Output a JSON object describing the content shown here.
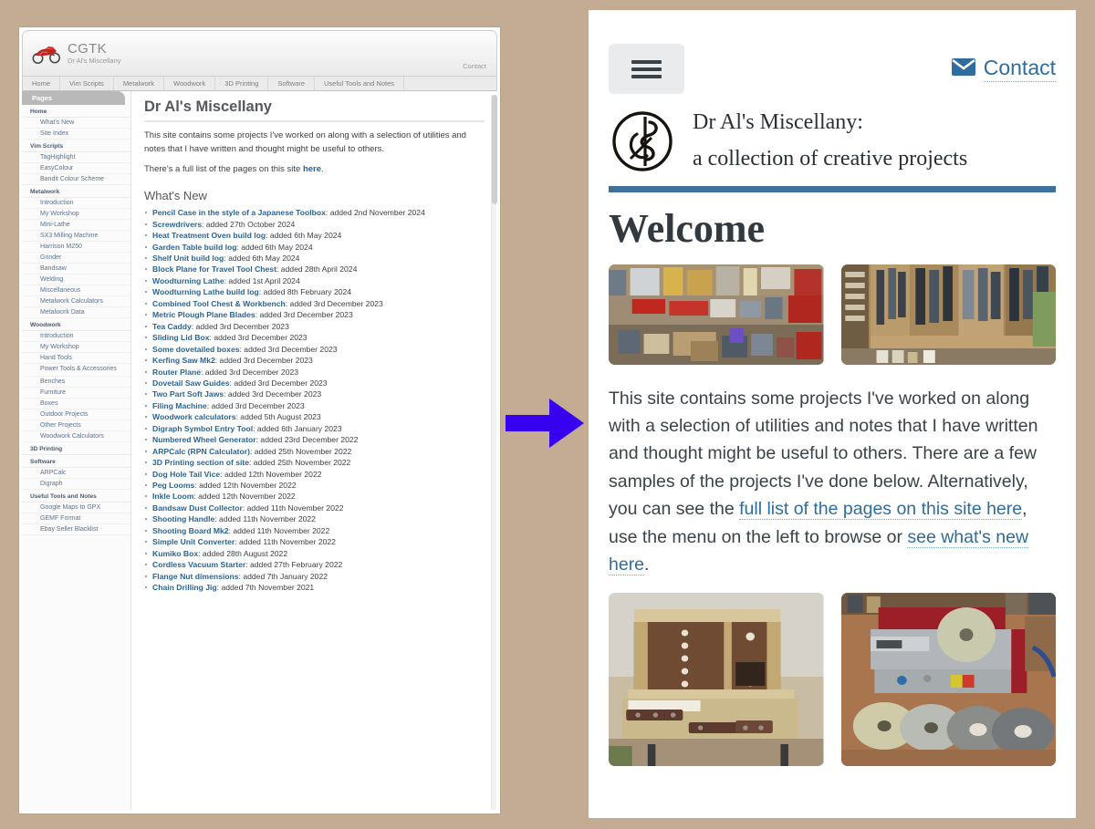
{
  "arrow": {
    "color": "#3700ee",
    "direction": "right"
  },
  "page_background": "#c3ab94",
  "desktop": {
    "header": {
      "brand_title": "CGTK",
      "brand_subtitle": "Dr Al's Miscellany",
      "contact_label": "Contact",
      "logo_icon": "motorcycle-icon"
    },
    "nav": [
      "Home",
      "Vim Scripts",
      "Metalwork",
      "Woodwork",
      "3D Printing",
      "Software",
      "Useful Tools and Notes"
    ],
    "sidebar": {
      "header": "Pages",
      "entries": [
        {
          "type": "group",
          "label": "Home"
        },
        {
          "type": "link",
          "label": "What's New"
        },
        {
          "type": "link",
          "label": "Site Index"
        },
        {
          "type": "group",
          "label": "Vim Scripts"
        },
        {
          "type": "link",
          "label": "TagHighlight"
        },
        {
          "type": "link",
          "label": "EasyColour"
        },
        {
          "type": "link",
          "label": "Bandit Colour Scheme"
        },
        {
          "type": "group",
          "label": "Metalwork"
        },
        {
          "type": "link",
          "label": "Introduction"
        },
        {
          "type": "link",
          "label": "My Workshop"
        },
        {
          "type": "link",
          "label": "Mini-Lathe"
        },
        {
          "type": "link",
          "label": "SX3 Milling Machine"
        },
        {
          "type": "link",
          "label": "Harrison M250"
        },
        {
          "type": "link",
          "label": "Grinder"
        },
        {
          "type": "link",
          "label": "Bandsaw"
        },
        {
          "type": "link",
          "label": "Welding"
        },
        {
          "type": "link",
          "label": "Miscellaneous"
        },
        {
          "type": "link",
          "label": "Metalwork Calculators"
        },
        {
          "type": "link",
          "label": "Metalwork Data"
        },
        {
          "type": "group",
          "label": "Woodwork"
        },
        {
          "type": "link",
          "label": "Introduction"
        },
        {
          "type": "link",
          "label": "My Workshop"
        },
        {
          "type": "link",
          "label": "Hand Tools"
        },
        {
          "type": "link",
          "label": "Power Tools & Accessories",
          "wrap": true
        },
        {
          "type": "link",
          "label": "Benches"
        },
        {
          "type": "link",
          "label": "Furniture"
        },
        {
          "type": "link",
          "label": "Boxes"
        },
        {
          "type": "link",
          "label": "Outdoor Projects"
        },
        {
          "type": "link",
          "label": "Other Projects"
        },
        {
          "type": "link",
          "label": "Woodwork Calculators"
        },
        {
          "type": "group",
          "label": "3D Printing"
        },
        {
          "type": "group",
          "label": "Software"
        },
        {
          "type": "link",
          "label": "ARPCalc"
        },
        {
          "type": "link",
          "label": "Digraph"
        },
        {
          "type": "group",
          "label": "Useful Tools and Notes"
        },
        {
          "type": "link",
          "label": "Google Maps to GPX"
        },
        {
          "type": "link",
          "label": "GEMF Format"
        },
        {
          "type": "link",
          "label": "Ebay Seller Blacklist"
        }
      ]
    },
    "main": {
      "title": "Dr Al's Miscellany",
      "intro_text_before": "This site contains some projects I've worked on along with a selection of utilities and notes that I have written and thought might be useful to others.",
      "list_line_before": "There's a full list of the pages on this site ",
      "list_line_link": "here",
      "list_line_after": ".",
      "whats_new_heading": "What's New",
      "whats_new": [
        {
          "link": "Pencil Case in the style of a Japanese Toolbox",
          "rest": ": added 2nd November 2024"
        },
        {
          "link": "Screwdrivers",
          "rest": ": added 27th October 2024"
        },
        {
          "link": "Heat Treatment Oven build log",
          "rest": ": added 6th May 2024"
        },
        {
          "link": "Garden Table build log",
          "rest": ": added 6th May 2024"
        },
        {
          "link": "Shelf Unit build log",
          "rest": ": added 6th May 2024"
        },
        {
          "link": "Block Plane for Travel Tool Chest",
          "rest": ": added 28th April 2024"
        },
        {
          "link": "Woodturning Lathe",
          "rest": ": added 1st April 2024"
        },
        {
          "link": "Woodturning Lathe build log",
          "rest": ": added 8th February 2024"
        },
        {
          "link": "Combined Tool Chest & Workbench",
          "rest": ": added 3rd December 2023"
        },
        {
          "link": "Metric Plough Plane Blades",
          "rest": ": added 3rd December 2023"
        },
        {
          "link": "Tea Caddy",
          "rest": ": added 3rd December 2023"
        },
        {
          "link": "Sliding Lid Box",
          "rest": ": added 3rd December 2023"
        },
        {
          "link": "Some dovetailed boxes",
          "rest": ": added 3rd December 2023"
        },
        {
          "link": "Kerfing Saw Mk2",
          "rest": ": added 3rd December 2023"
        },
        {
          "link": "Router Plane",
          "rest": ": added 3rd December 2023"
        },
        {
          "link": "Dovetail Saw Guides",
          "rest": ": added 3rd December 2023"
        },
        {
          "link": "Two Part Soft Jaws",
          "rest": ": added 3rd December 2023"
        },
        {
          "link": "Filing Machine",
          "rest": ": added 3rd December 2023"
        },
        {
          "link": "Woodwork calculators",
          "rest": ": added 5th August 2023"
        },
        {
          "link": "Digraph Symbol Entry Tool",
          "rest": ": added 6th January 2023"
        },
        {
          "link": "Numbered Wheel Generator",
          "rest": ": added 23rd December 2022"
        },
        {
          "link": "ARPCalc (RPN Calculator)",
          "rest": ": added 25th November 2022"
        },
        {
          "link": "3D Printing section of site",
          "rest": ": added 25th November 2022"
        },
        {
          "link": "Dog Hole Tail Vice",
          "rest": ": added 12th November 2022"
        },
        {
          "link": "Peg Looms",
          "rest": ": added 12th November 2022"
        },
        {
          "link": "Inkle Loom",
          "rest": ": added 12th November 2022"
        },
        {
          "link": "Bandsaw Dust Collector",
          "rest": ": added 11th November 2022"
        },
        {
          "link": "Shooting Handle",
          "rest": ": added 11th November 2022"
        },
        {
          "link": "Shooting Board Mk2",
          "rest": ": added 11th November 2022"
        },
        {
          "link": "Simple Unit Converter",
          "rest": ": added 11th November 2022"
        },
        {
          "link": "Kumiko Box",
          "rest": ": added 28th August 2022"
        },
        {
          "link": "Cordless Vacuum Starter",
          "rest": ": added 27th February 2022"
        },
        {
          "link": "Flange Nut dimensions",
          "rest": ": added 7th January 2022"
        },
        {
          "link": "Chain Drilling Jig",
          "rest": ": added 7th November 2021"
        }
      ]
    }
  },
  "mobile": {
    "menu_icon": "hamburger-menu-icon",
    "contact_icon": "envelope-icon",
    "contact_label": "Contact",
    "logo_icon": "monogram-circle-logo",
    "title_line1": "Dr Al's Miscellany:",
    "title_line2": "a collection of creative projects",
    "accent_color": "#3d709b",
    "heading": "Welcome",
    "photos_top": [
      "metalwork-workshop-photo",
      "woodwork-tool-wall-photo"
    ],
    "photos_bottom": [
      "tool-chest-photo",
      "grinder-machine-photo"
    ],
    "body_part1": "This site contains some projects I've worked on along with a selection of utilities and notes that I have written and thought might be useful to others. There are a few samples of the projects I've done below. Alternatively, you can see the ",
    "body_link1": "full list of the pages on this site here",
    "body_part2": ", use the menu on the left to browse or ",
    "body_link2": "see what's new here",
    "body_part3": "."
  }
}
